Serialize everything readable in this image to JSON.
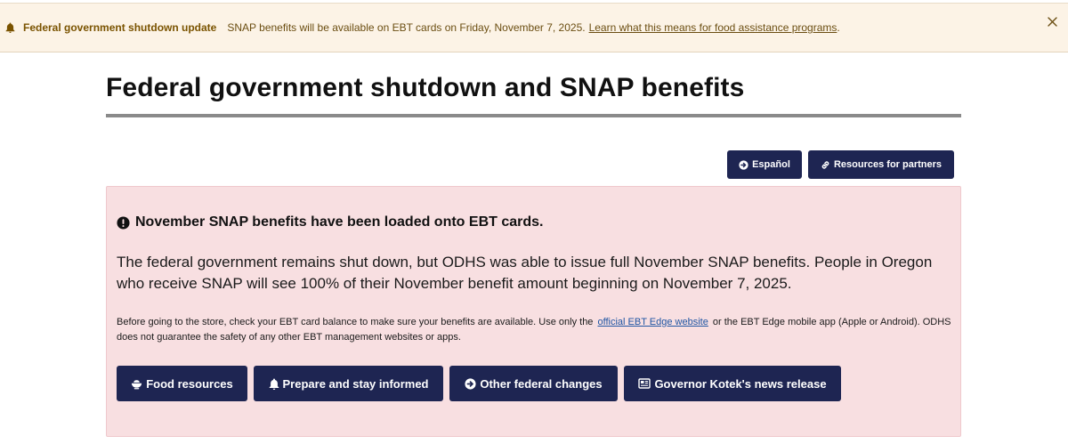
{
  "alert": {
    "icon": "bell-icon",
    "title": "Federal government shutdown update",
    "text": "SNAP benefits will be available on EBT cards on Friday, November 7, 2025.",
    "link": "Learn what this means for food assistance programs",
    "trailing": ".",
    "close_icon": "close-icon",
    "colors": {
      "background": "#fcf3e6",
      "title": "#7a5300"
    }
  },
  "page": {
    "title": "Federal government shutdown and SNAP benefits"
  },
  "top_buttons": {
    "espanol": {
      "label": "Español",
      "icon": "arrow-circle-right-icon"
    },
    "partners": {
      "label": "Resources for partners",
      "icon": "link-icon"
    }
  },
  "notice": {
    "heading_icon": "exclamation-circle-icon",
    "heading": "November SNAP benefits have been loaded onto EBT cards.",
    "lead": "The federal government remains shut down, but ODHS was able to issue full November SNAP benefits. People in Oregon who receive SNAP will see 100% of their November benefit amount beginning on November 7, 2025.",
    "small_before": "Before going to the store, check your EBT card balance to make sure your benefits are available. Use only the",
    "small_link": "official EBT Edge website",
    "small_after": "or the EBT Edge mobile app (Apple or Android). ODHS does not guarantee the safety of any other EBT management websites or apps.",
    "colors": {
      "background": "#f8dfe1",
      "link": "#1f55a3"
    }
  },
  "actions": {
    "food": {
      "label": "Food resources",
      "icon": "food-bowl-icon"
    },
    "prepare": {
      "label": "Prepare and stay informed",
      "icon": "bell-icon"
    },
    "other": {
      "label": "Other federal changes",
      "icon": "arrow-circle-right-icon"
    },
    "news": {
      "label": "Governor Kotek's news release",
      "icon": "newspaper-icon"
    }
  },
  "button_color": "#1e2552"
}
